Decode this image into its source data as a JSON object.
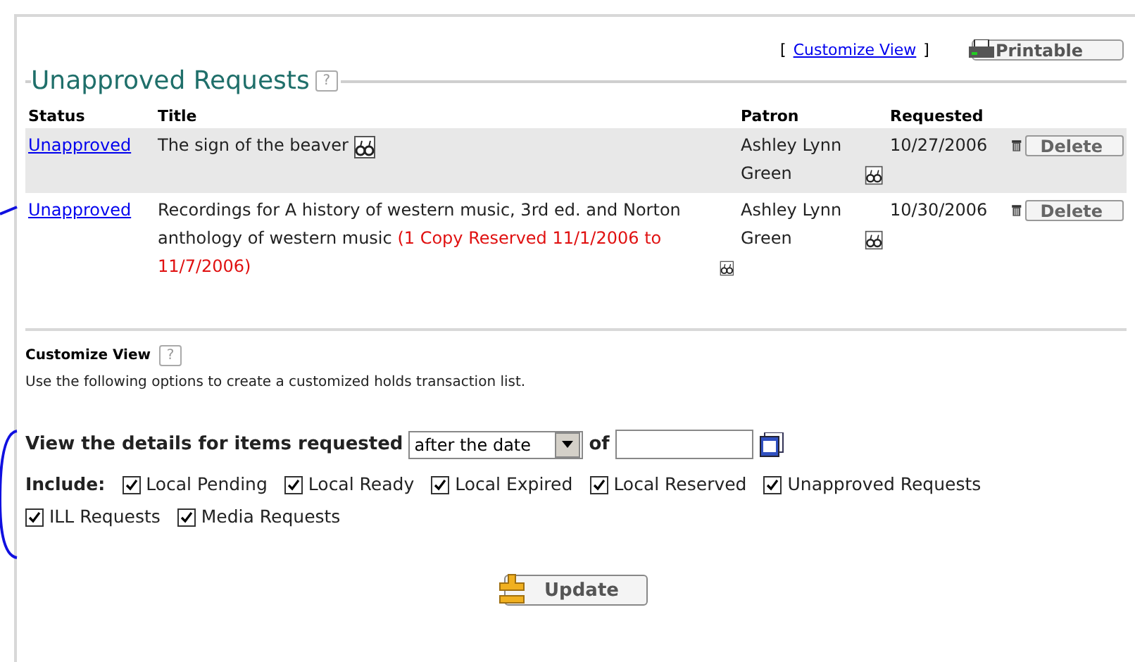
{
  "header": {
    "bracket_open": "[",
    "customize_link": "Customize View",
    "bracket_close": "]",
    "printable_button": "Printable"
  },
  "section": {
    "title": "Unapproved Requests",
    "help": "?"
  },
  "table": {
    "columns": [
      "Status",
      "Title",
      "Patron",
      "Requested"
    ],
    "rows": [
      {
        "status": "Unapproved",
        "title": "The sign of the beaver",
        "patron": "Ashley Lynn Green",
        "requested": "10/27/2006",
        "action": "Delete"
      },
      {
        "status": "Unapproved",
        "title": "Recordings for A history of western music, 3rd ed. and Norton anthology of western music",
        "note": "(1 Copy Reserved 11/1/2006 to 11/7/2006)",
        "patron": "Ashley Lynn Green",
        "requested": "10/30/2006",
        "action": "Delete"
      }
    ]
  },
  "customize": {
    "title": "Customize View",
    "help": "?",
    "description": "Use the following options to create a customized holds transaction list.",
    "details_label": "View the details for items requested",
    "date_filter": "after the date",
    "of_label": "of",
    "include_label": "Include:",
    "options": [
      {
        "label": "Local Pending",
        "checked": true
      },
      {
        "label": "Local Ready",
        "checked": true
      },
      {
        "label": "Local Expired",
        "checked": true
      },
      {
        "label": "Local Reserved",
        "checked": true
      },
      {
        "label": "Unapproved Requests",
        "checked": true
      },
      {
        "label": "ILL Requests",
        "checked": true
      },
      {
        "label": "Media Requests",
        "checked": true
      }
    ],
    "update_button": "Update"
  }
}
